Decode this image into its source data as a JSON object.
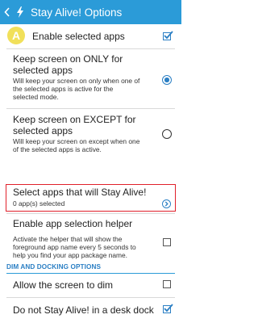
{
  "actionbar": {
    "title": "Stay Alive! Options"
  },
  "colors": {
    "accent": "#2b9bd8",
    "highlight": "#e0202a"
  },
  "prefs": [
    {
      "title": "Enable selected apps",
      "summary": "",
      "widget": "checkbox",
      "checked": true,
      "icon": "app-letter-a-icon"
    },
    {
      "title_lines": [
        "Keep screen on ONLY for",
        "selected apps"
      ],
      "summary_lines": [
        "Will keep your screen on only when one of",
        "the selected apps is active for the",
        "selected mode."
      ],
      "widget": "radio",
      "checked": true
    },
    {
      "title_lines": [
        "Keep screen on EXCEPT for",
        "selected apps"
      ],
      "summary_lines": [
        "Will keep your screen on except when one",
        "of the selected apps is active."
      ],
      "widget": "radio",
      "checked": false
    },
    {
      "title": "Select apps that will Stay Alive!",
      "summary": "0 app(s) selected",
      "widget": "chevron"
    },
    {
      "title": "Enable app selection helper",
      "summary_lines": [
        "Activate the helper that will show the",
        "foreground app name every 5 seconds to",
        "help you find your app package name."
      ],
      "widget": "checkbox",
      "checked": false
    }
  ],
  "section": {
    "label": "DIM AND DOCKING OPTIONS"
  },
  "prefs2": [
    {
      "title": "Allow the screen to dim",
      "widget": "checkbox",
      "checked": false
    },
    {
      "title": "Do not Stay Alive! in a desk dock",
      "widget": "checkbox",
      "checked": true
    }
  ]
}
